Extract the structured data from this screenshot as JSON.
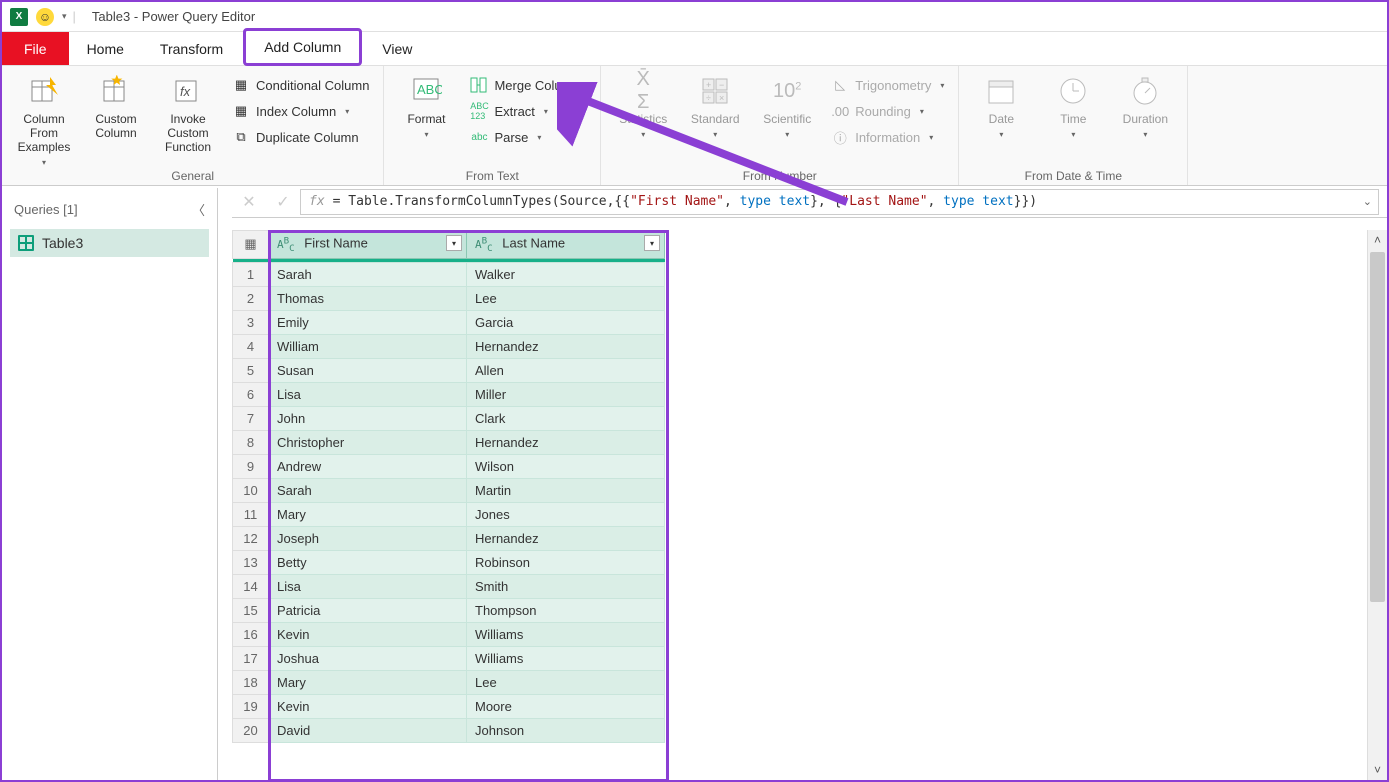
{
  "titlebar": {
    "title": "Table3 - Power Query Editor"
  },
  "tabs": {
    "file": "File",
    "home": "Home",
    "transform": "Transform",
    "addcolumn": "Add Column",
    "view": "View"
  },
  "ribbon": {
    "general": {
      "label": "General",
      "column_from_examples": "Column From Examples",
      "custom_column": "Custom Column",
      "invoke_custom_function": "Invoke Custom Function",
      "conditional_column": "Conditional Column",
      "index_column": "Index Column",
      "duplicate_column": "Duplicate Column"
    },
    "from_text": {
      "label": "From Text",
      "format": "Format",
      "merge_columns": "Merge Columns",
      "extract": "Extract",
      "parse": "Parse"
    },
    "from_number": {
      "label": "From Number",
      "statistics": "Statistics",
      "standard": "Standard",
      "scientific": "Scientific",
      "trigonometry": "Trigonometry",
      "rounding": "Rounding",
      "information": "Information"
    },
    "from_datetime": {
      "label": "From Date & Time",
      "date": "Date",
      "time": "Time",
      "duration": "Duration"
    }
  },
  "formula": {
    "prefix": "= Table.TransformColumnTypes(Source,{{",
    "str1": "\"First Name\"",
    "mid1": ", ",
    "kw1": "type text",
    "mid2": "}, {",
    "str2": "\"Last Name\"",
    "mid3": ", ",
    "kw2": "type text",
    "suffix": "}})"
  },
  "queries": {
    "header": "Queries [1]",
    "items": [
      "Table3"
    ]
  },
  "columns": [
    "First Name",
    "Last Name"
  ],
  "rows": [
    [
      "Sarah",
      "Walker"
    ],
    [
      "Thomas",
      "Lee"
    ],
    [
      "Emily",
      "Garcia"
    ],
    [
      "William",
      "Hernandez"
    ],
    [
      "Susan",
      "Allen"
    ],
    [
      "Lisa",
      "Miller"
    ],
    [
      "John",
      "Clark"
    ],
    [
      "Christopher",
      "Hernandez"
    ],
    [
      "Andrew",
      "Wilson"
    ],
    [
      "Sarah",
      "Martin"
    ],
    [
      "Mary",
      "Jones"
    ],
    [
      "Joseph",
      "Hernandez"
    ],
    [
      "Betty",
      "Robinson"
    ],
    [
      "Lisa",
      "Smith"
    ],
    [
      "Patricia",
      "Thompson"
    ],
    [
      "Kevin",
      "Williams"
    ],
    [
      "Joshua",
      "Williams"
    ],
    [
      "Mary",
      "Lee"
    ],
    [
      "Kevin",
      "Moore"
    ],
    [
      "David",
      "Johnson"
    ]
  ]
}
